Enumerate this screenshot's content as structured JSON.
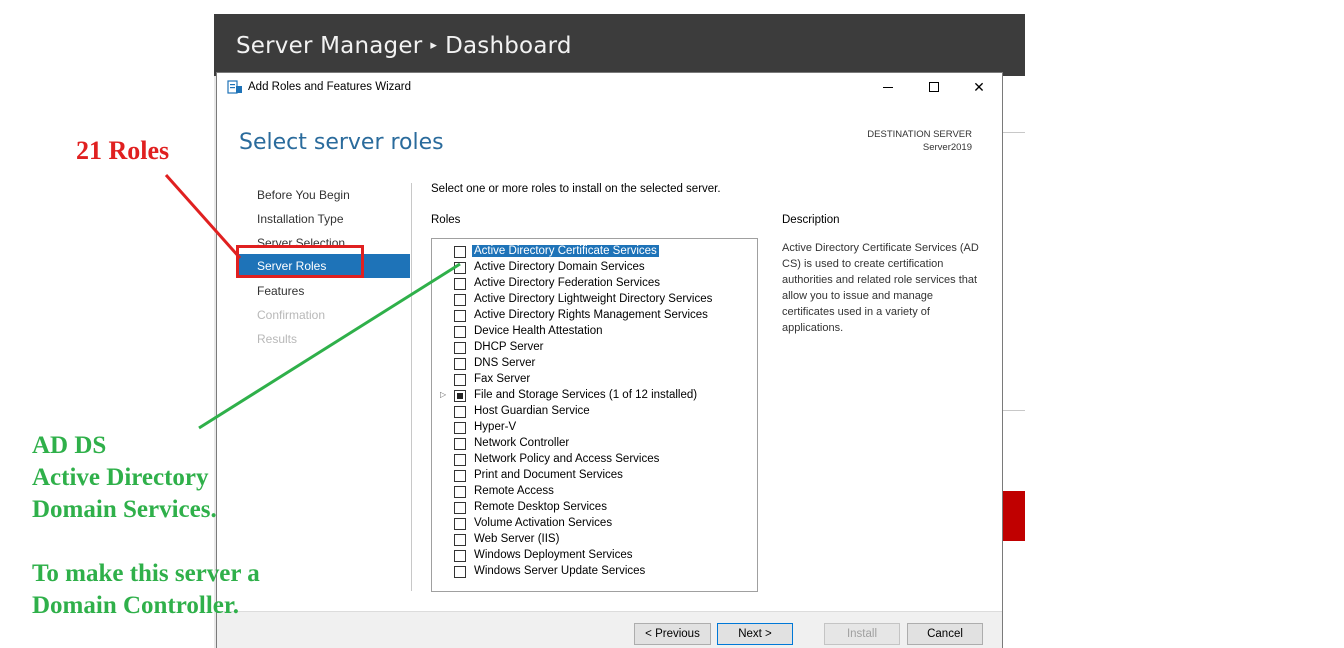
{
  "server_manager": {
    "title": "Server Manager",
    "breadcrumb_sep": "▸",
    "page": "Dashboard"
  },
  "wizard": {
    "title": "Add Roles and Features Wizard",
    "heading": "Select server roles",
    "destination_label": "DESTINATION SERVER",
    "destination_name": "Server2019",
    "instruction": "Select one or more roles to install on the selected server.",
    "roles_label": "Roles",
    "description_label": "Description",
    "description_text": "Active Directory Certificate Services (AD CS) is used to create certification authorities and related role services that allow you to issue and manage certificates used in a variety of applications.",
    "nav": [
      {
        "label": "Before You Begin",
        "state": "normal"
      },
      {
        "label": "Installation Type",
        "state": "normal"
      },
      {
        "label": "Server Selection",
        "state": "normal"
      },
      {
        "label": "Server Roles",
        "state": "selected"
      },
      {
        "label": "Features",
        "state": "normal"
      },
      {
        "label": "Confirmation",
        "state": "disabled"
      },
      {
        "label": "Results",
        "state": "disabled"
      }
    ],
    "roles": [
      {
        "label": "Active Directory Certificate Services",
        "checked": false,
        "selected": true
      },
      {
        "label": "Active Directory Domain Services",
        "checked": false
      },
      {
        "label": "Active Directory Federation Services",
        "checked": false
      },
      {
        "label": "Active Directory Lightweight Directory Services",
        "checked": false
      },
      {
        "label": "Active Directory Rights Management Services",
        "checked": false
      },
      {
        "label": "Device Health Attestation",
        "checked": false
      },
      {
        "label": "DHCP Server",
        "checked": false
      },
      {
        "label": "DNS Server",
        "checked": false
      },
      {
        "label": "Fax Server",
        "checked": false
      },
      {
        "label": "File and Storage Services (1 of 12 installed)",
        "checked": "partial",
        "expandable": true
      },
      {
        "label": "Host Guardian Service",
        "checked": false
      },
      {
        "label": "Hyper-V",
        "checked": false
      },
      {
        "label": "Network Controller",
        "checked": false
      },
      {
        "label": "Network Policy and Access Services",
        "checked": false
      },
      {
        "label": "Print and Document Services",
        "checked": false
      },
      {
        "label": "Remote Access",
        "checked": false
      },
      {
        "label": "Remote Desktop Services",
        "checked": false
      },
      {
        "label": "Volume Activation Services",
        "checked": false
      },
      {
        "label": "Web Server (IIS)",
        "checked": false
      },
      {
        "label": "Windows Deployment Services",
        "checked": false
      },
      {
        "label": "Windows Server Update Services",
        "checked": false
      }
    ],
    "buttons": {
      "previous": "< Previous",
      "next": "Next >",
      "install": "Install",
      "cancel": "Cancel"
    }
  },
  "annotations": {
    "roles_count": "21 Roles",
    "green_lines": [
      "AD DS",
      "Active Directory",
      "Domain Services.",
      "",
      "To make this server a",
      "Domain Controller."
    ],
    "red_color": "#e02020",
    "green_color": "#2fb04a"
  }
}
